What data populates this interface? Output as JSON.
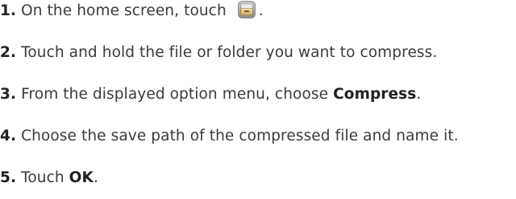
{
  "steps": [
    {
      "number": "1.",
      "text_before": " On the home screen, touch ",
      "icon": "file-manager-icon",
      "text_after": "."
    },
    {
      "number": "2.",
      "text": " Touch and hold the file or folder you want to compress."
    },
    {
      "number": "3.",
      "text_before": " From the displayed option menu, choose ",
      "bold": "Compress",
      "text_after": "."
    },
    {
      "number": "4.",
      "text": " Choose the save path of the compressed file and name it."
    },
    {
      "number": "5.",
      "text_before": " Touch ",
      "bold": "OK",
      "text_after": "."
    }
  ]
}
